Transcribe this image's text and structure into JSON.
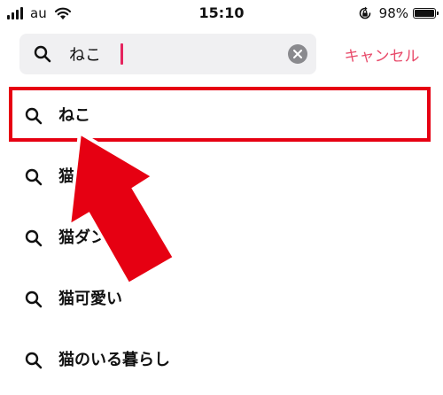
{
  "status_bar": {
    "carrier": "au",
    "time": "15:10",
    "battery_percent": "98%",
    "battery_level": 0.98,
    "icons": [
      "signal-bars-icon",
      "wifi-icon",
      "rotation-lock-icon",
      "battery-icon"
    ]
  },
  "search": {
    "value": "ねこ",
    "clear_icon": "clear-x-icon",
    "search_icon": "magnifier-icon",
    "caret_color": "#e5245e"
  },
  "cancel_label": "キャンセル",
  "suggestions": [
    {
      "label": "ねこ"
    },
    {
      "label": "猫"
    },
    {
      "label": "猫ダン."
    },
    {
      "label": "猫可愛い"
    },
    {
      "label": "猫のいる暮らし"
    }
  ],
  "colors": {
    "accent": "#e84a6a",
    "annotation": "#e60012",
    "search_background": "#f0f0f2"
  }
}
